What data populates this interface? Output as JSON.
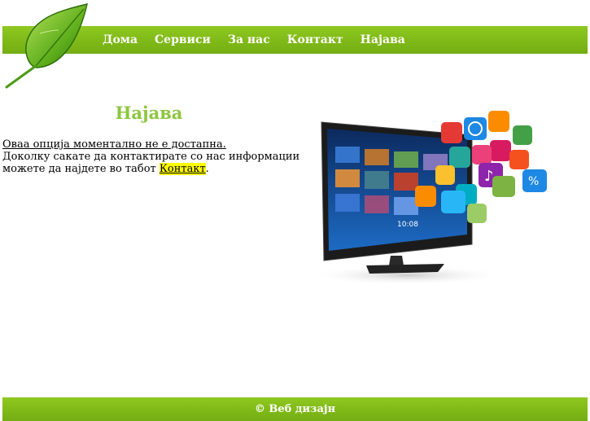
{
  "nav": {
    "items": [
      "Дома",
      "Сервиси",
      "За нас",
      "Контакт",
      "Најава"
    ]
  },
  "main": {
    "title": "Најава",
    "line1": "Оваа опција моментално не е достапна.",
    "line2": "Доколку сакате да контактирате со нас информации",
    "line3_prefix": "можете да најдете во табот ",
    "contact_link": "Контакт",
    "line3_suffix": "."
  },
  "footer": {
    "text": "© Веб дизајн"
  },
  "colors": {
    "brand_green": "#7ab317",
    "title_green": "#8dc63f",
    "link_highlight": "#ffff00"
  },
  "icons": [
    "leaf-logo-icon",
    "tv-apps-illustration"
  ]
}
